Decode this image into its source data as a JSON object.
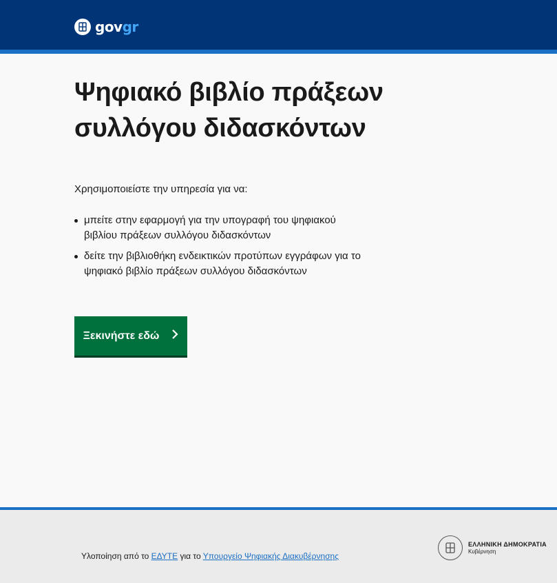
{
  "header": {
    "logo_gov": "gov",
    "logo_gr": "gr",
    "logo_icon": "greek-emblem-icon"
  },
  "main": {
    "title_line1": "Ψηφιακό βιβλίο πράξεων",
    "title_line2": "συλλόγου διδασκόντων",
    "intro": "Χρησιμοποιείστε την υπηρεσία για να:",
    "bullets": [
      "μπείτε στην εφαρμογή για την υπογραφή του ψηφιακού βιβλίου πράξεων συλλόγου διδασκόντων",
      "δείτε την βιβλιοθήκη ενδεικτικών προτύπων εγγράφων για το ψηφιακό βιβλίο πράξεων συλλόγου διδασκόντων"
    ],
    "start_button": "Ξεκινήστε εδώ",
    "start_icon": "chevron-right-icon"
  },
  "footer": {
    "prefix": "Υλοποίηση από το ",
    "link1": "ΕΔΥΤΕ",
    "middle": " για το ",
    "link2": "Υπουργείο Ψηφιακής Διακυβέρνησης",
    "gov_name": "ΕΛΛΗΝΙΚΗ ΔΗΜΟΚΡΑΤΙΑ",
    "gov_sub": "Κυβέρνηση",
    "gov_icon": "hellenic-republic-emblem-icon"
  },
  "colors": {
    "header_bg": "#003476",
    "accent_blue": "#1b6fc4",
    "button_green": "#00703c",
    "footer_bg": "#ebebeb"
  }
}
